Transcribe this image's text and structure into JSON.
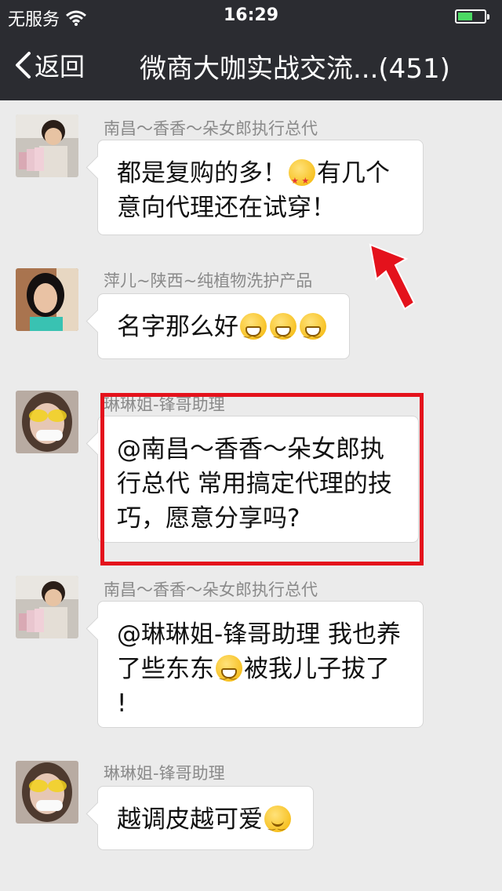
{
  "status_bar": {
    "carrier": "无服务",
    "time": "16:29"
  },
  "nav": {
    "back_label": "返回",
    "title": "微商大咖实战交流...(451)"
  },
  "messages": [
    {
      "sender": "南昌～香香～朵女郎执行总代",
      "text_a": "都是复购的多！",
      "text_b": "有几个",
      "text_c": "意向代理还在试穿！"
    },
    {
      "sender": "萍儿~陕西~纯植物洗护产品",
      "text_a": "名字那么好"
    },
    {
      "sender": "琳琳姐-锋哥助理",
      "text_a": "@南昌～香香～朵女郎执",
      "text_b": "行总代 常用搞定代理的技",
      "text_c": "巧，愿意分享吗?"
    },
    {
      "sender": "南昌～香香～朵女郎执行总代",
      "text_a": "@琳琳姐-锋哥助理 我也养",
      "text_b": "了些东东",
      "text_c": "被我儿子拔了",
      "text_d": "!"
    },
    {
      "sender": "琳琳姐-锋哥助理",
      "text_a": "越调皮越可爱"
    }
  ],
  "colors": {
    "header_bg": "#2b2c31",
    "chat_bg": "#ebebeb",
    "annotation_red": "#e4121c",
    "battery_green": "#4cd964"
  }
}
